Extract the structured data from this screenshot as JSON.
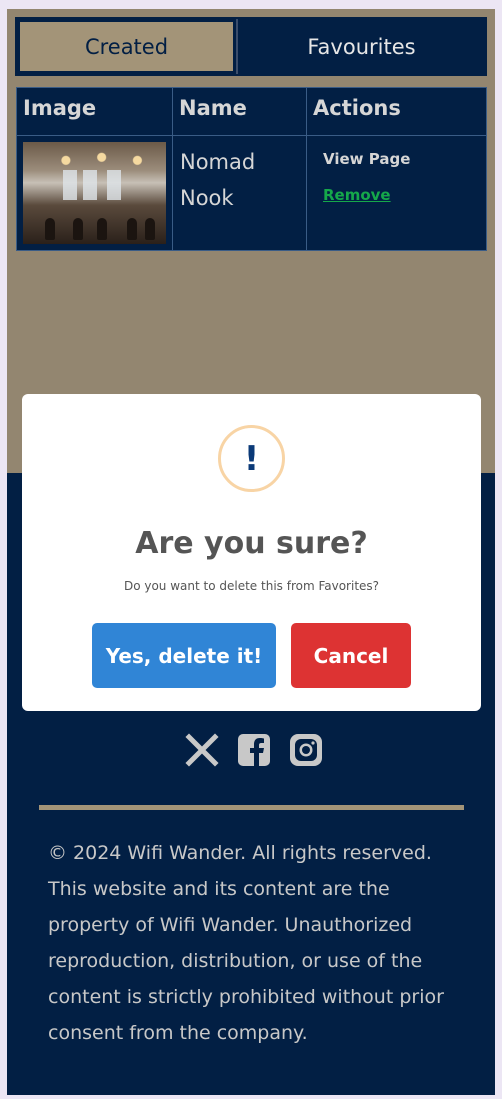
{
  "tabs": [
    {
      "label": "Created",
      "active": true
    },
    {
      "label": "Favourites",
      "active": false
    }
  ],
  "table": {
    "headers": [
      "Image",
      "Name",
      "Actions"
    ],
    "rows": [
      {
        "name": "Nomad Nook",
        "view_label": "View Page",
        "remove_label": "Remove"
      }
    ]
  },
  "modal": {
    "icon": "!",
    "title": "Are you sure?",
    "text": "Do you want to delete this from Favorites?",
    "confirm_label": "Yes, delete it!",
    "cancel_label": "Cancel"
  },
  "footer": {
    "social": [
      "x-icon",
      "facebook-icon",
      "instagram-icon"
    ],
    "copyright": "© 2024 Wifi Wander. All rights reserved. This website and its content are the property of Wifi Wander. Unauthorized reproduction, distribution, or use of the content is strictly prohibited without prior consent from the company."
  },
  "colors": {
    "navy": "#021f44",
    "tan": "#938670",
    "confirm": "#3085d6",
    "cancel": "#dd3333",
    "remove_link": "#15a84a"
  }
}
